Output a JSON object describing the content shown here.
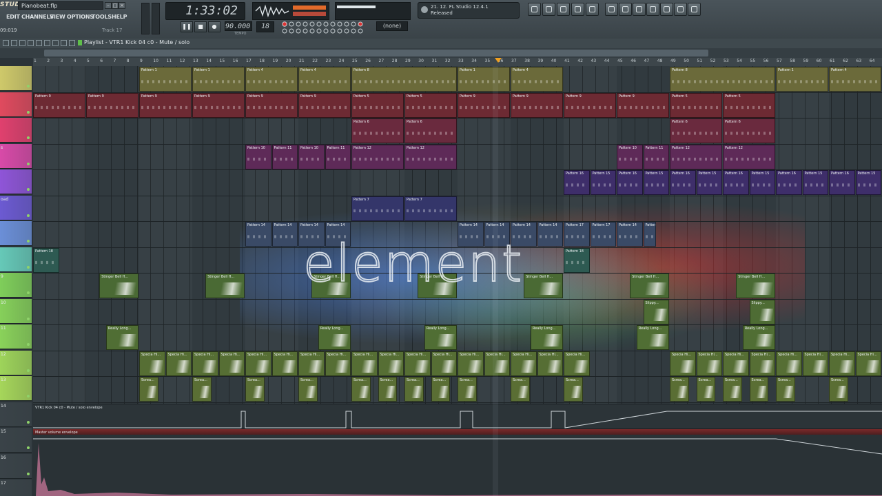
{
  "app": {
    "logo": "STUDIO",
    "filename": "Pianobeat.flp",
    "cpu": "09:019",
    "track": "Track 17"
  },
  "menu": [
    {
      "label": "EDIT"
    },
    {
      "label": "CHANNELS"
    },
    {
      "label": "VIEW"
    },
    {
      "label": "OPTIONS"
    },
    {
      "label": "TOOLS"
    },
    {
      "label": "HELP"
    }
  ],
  "transport": {
    "time": "1:33:02",
    "tempo": "90.000",
    "pattern": "18",
    "snap": "(none)",
    "tempo_label": "TEMPO"
  },
  "hint": {
    "line1": "21. 12. FL Studio 12.4.1",
    "line2": "Released"
  },
  "playlist": {
    "title": "Playlist - VTR1 Kick 04 c0 - Mute / solo"
  },
  "ruler": {
    "bars": [
      "1",
      "2",
      "3",
      "4",
      "5",
      "6",
      "7",
      "8",
      "9",
      "10",
      "11",
      "12",
      "13",
      "14",
      "15",
      "16",
      "17",
      "18",
      "19",
      "20",
      "21",
      "22",
      "23",
      "24",
      "25",
      "26",
      "27",
      "28",
      "29",
      "30",
      "31",
      "32",
      "33",
      "34",
      "35",
      "36",
      "37",
      "38",
      "39",
      "40",
      "41",
      "42",
      "43",
      "44",
      "45",
      "46",
      "47",
      "48",
      "49",
      "50",
      "51",
      "52",
      "53",
      "54",
      "55",
      "56",
      "57",
      "58",
      "59",
      "60",
      "61",
      "62",
      "63",
      "64"
    ]
  },
  "tracks": [
    {
      "num": "",
      "color": "#cfc96a"
    },
    {
      "num": "",
      "color": "#e04a5e"
    },
    {
      "num": "",
      "color": "#e0406e"
    },
    {
      "num": "s",
      "color": "#d84aa8"
    },
    {
      "num": "",
      "color": "#8f55d8"
    },
    {
      "num": "oad",
      "color": "#6c5ad2"
    },
    {
      "num": "",
      "color": "#6b8fd8"
    },
    {
      "num": "",
      "color": "#66c9b8"
    },
    {
      "num": "9",
      "color": "#7fce5a"
    },
    {
      "num": "10",
      "color": "#86d05a"
    },
    {
      "num": "11",
      "color": "#8ad25a"
    },
    {
      "num": "12",
      "color": "#9ed45a"
    },
    {
      "num": "13",
      "color": "#a6d65a"
    },
    {
      "num": "14",
      "color": "#3a4348"
    },
    {
      "num": "15",
      "color": "#3a4348"
    },
    {
      "num": "16",
      "color": "#3a4348"
    },
    {
      "num": "17",
      "color": "#3a4348"
    }
  ],
  "clips": [
    {
      "label": "Pattern 1",
      "row": 0,
      "start": 8,
      "len": 4,
      "color": "#6b6a3a"
    },
    {
      "label": "Pattern 1",
      "row": 0,
      "start": 12,
      "len": 4,
      "color": "#6b6a3a"
    },
    {
      "label": "Pattern 4",
      "row": 0,
      "start": 16,
      "len": 4,
      "color": "#6b6a3a"
    },
    {
      "label": "Pattern 4",
      "row": 0,
      "start": 20,
      "len": 4,
      "color": "#6b6a3a"
    },
    {
      "label": "Pattern 8",
      "row": 0,
      "start": 24,
      "len": 8,
      "color": "#6b6a3a"
    },
    {
      "label": "Pattern 1",
      "row": 0,
      "start": 32,
      "len": 4,
      "color": "#6b6a3a"
    },
    {
      "label": "Pattern 4",
      "row": 0,
      "start": 36,
      "len": 4,
      "color": "#6b6a3a"
    },
    {
      "label": "Pattern 8",
      "row": 0,
      "start": 48,
      "len": 8,
      "color": "#6b6a3a"
    },
    {
      "label": "Pattern 1",
      "row": 0,
      "start": 56,
      "len": 4,
      "color": "#6b6a3a"
    },
    {
      "label": "Pattern 4",
      "row": 0,
      "start": 60,
      "len": 4,
      "color": "#6b6a3a"
    },
    {
      "label": "Pattern 9",
      "row": 1,
      "start": 0,
      "len": 4,
      "color": "#6d2a33"
    },
    {
      "label": "Pattern 9",
      "row": 1,
      "start": 4,
      "len": 4,
      "color": "#6d2a33"
    },
    {
      "label": "Pattern 9",
      "row": 1,
      "start": 8,
      "len": 4,
      "color": "#6d2a33"
    },
    {
      "label": "Pattern 9",
      "row": 1,
      "start": 12,
      "len": 4,
      "color": "#6d2a33"
    },
    {
      "label": "Pattern 9",
      "row": 1,
      "start": 16,
      "len": 4,
      "color": "#6d2a33"
    },
    {
      "label": "Pattern 9",
      "row": 1,
      "start": 20,
      "len": 4,
      "color": "#6d2a33"
    },
    {
      "label": "Pattern 5",
      "row": 1,
      "start": 24,
      "len": 4,
      "color": "#6d2a33"
    },
    {
      "label": "Pattern 5",
      "row": 1,
      "start": 28,
      "len": 4,
      "color": "#6d2a33"
    },
    {
      "label": "Pattern 9",
      "row": 1,
      "start": 32,
      "len": 4,
      "color": "#6d2a33"
    },
    {
      "label": "Pattern 9",
      "row": 1,
      "start": 36,
      "len": 4,
      "color": "#6d2a33"
    },
    {
      "label": "Pattern 9",
      "row": 1,
      "start": 40,
      "len": 4,
      "color": "#6d2a33"
    },
    {
      "label": "Pattern 9",
      "row": 1,
      "start": 44,
      "len": 4,
      "color": "#6d2a33"
    },
    {
      "label": "Pattern 5",
      "row": 1,
      "start": 48,
      "len": 4,
      "color": "#6d2a33"
    },
    {
      "label": "Pattern 5",
      "row": 1,
      "start": 52,
      "len": 4,
      "color": "#6d2a33"
    },
    {
      "label": "Pattern 6",
      "row": 2,
      "start": 24,
      "len": 4,
      "color": "#6a2a3e"
    },
    {
      "label": "Pattern 6",
      "row": 2,
      "start": 28,
      "len": 4,
      "color": "#6a2a3e"
    },
    {
      "label": "Pattern 6",
      "row": 2,
      "start": 48,
      "len": 4,
      "color": "#6a2a3e"
    },
    {
      "label": "Pattern 6",
      "row": 2,
      "start": 52,
      "len": 4,
      "color": "#6a2a3e"
    },
    {
      "label": "Pattern 10",
      "row": 3,
      "start": 16,
      "len": 2,
      "color": "#5e2a58"
    },
    {
      "label": "Pattern 11",
      "row": 3,
      "start": 18,
      "len": 2,
      "color": "#5e2a58"
    },
    {
      "label": "Pattern 10",
      "row": 3,
      "start": 20,
      "len": 2,
      "color": "#5e2a58"
    },
    {
      "label": "Pattern 11",
      "row": 3,
      "start": 22,
      "len": 2,
      "color": "#5e2a58"
    },
    {
      "label": "Pattern 12",
      "row": 3,
      "start": 24,
      "len": 4,
      "color": "#5e2a58"
    },
    {
      "label": "Pattern 12",
      "row": 3,
      "start": 28,
      "len": 4,
      "color": "#5e2a58"
    },
    {
      "label": "Pattern 10",
      "row": 3,
      "start": 44,
      "len": 2,
      "color": "#5e2a58"
    },
    {
      "label": "Pattern 11",
      "row": 3,
      "start": 46,
      "len": 2,
      "color": "#5e2a58"
    },
    {
      "label": "Pattern 12",
      "row": 3,
      "start": 48,
      "len": 4,
      "color": "#5e2a58"
    },
    {
      "label": "Pattern 12",
      "row": 3,
      "start": 52,
      "len": 4,
      "color": "#5e2a58"
    },
    {
      "label": "Pattern 16",
      "row": 4,
      "start": 40,
      "len": 2,
      "color": "#3e2e6a"
    },
    {
      "label": "Pattern 15",
      "row": 4,
      "start": 42,
      "len": 2,
      "color": "#3e2e6a"
    },
    {
      "label": "Pattern 16",
      "row": 4,
      "start": 44,
      "len": 2,
      "color": "#3e2e6a"
    },
    {
      "label": "Pattern 15",
      "row": 4,
      "start": 46,
      "len": 2,
      "color": "#3e2e6a"
    },
    {
      "label": "Pattern 16",
      "row": 4,
      "start": 48,
      "len": 2,
      "color": "#3e2e6a"
    },
    {
      "label": "Pattern 15",
      "row": 4,
      "start": 50,
      "len": 2,
      "color": "#3e2e6a"
    },
    {
      "label": "Pattern 16",
      "row": 4,
      "start": 52,
      "len": 2,
      "color": "#3e2e6a"
    },
    {
      "label": "Pattern 15",
      "row": 4,
      "start": 54,
      "len": 2,
      "color": "#3e2e6a"
    },
    {
      "label": "Pattern 16",
      "row": 4,
      "start": 56,
      "len": 2,
      "color": "#3e2e6a"
    },
    {
      "label": "Pattern 15",
      "row": 4,
      "start": 58,
      "len": 2,
      "color": "#3e2e6a"
    },
    {
      "label": "Pattern 16",
      "row": 4,
      "start": 60,
      "len": 2,
      "color": "#3e2e6a"
    },
    {
      "label": "Pattern 15",
      "row": 4,
      "start": 62,
      "len": 2,
      "color": "#3e2e6a"
    },
    {
      "label": "Pattern 7",
      "row": 5,
      "start": 24,
      "len": 4,
      "color": "#34366a"
    },
    {
      "label": "Pattern 7",
      "row": 5,
      "start": 28,
      "len": 4,
      "color": "#34366a"
    },
    {
      "label": "Pattern 14",
      "row": 6,
      "start": 16,
      "len": 2,
      "color": "#3a4a66"
    },
    {
      "label": "Pattern 14",
      "row": 6,
      "start": 18,
      "len": 2,
      "color": "#3a4a66"
    },
    {
      "label": "Pattern 14",
      "row": 6,
      "start": 20,
      "len": 2,
      "color": "#3a4a66"
    },
    {
      "label": "Pattern 14",
      "row": 6,
      "start": 22,
      "len": 2,
      "color": "#3a4a66"
    },
    {
      "label": "Pattern 14",
      "row": 6,
      "start": 32,
      "len": 2,
      "color": "#3a4a66"
    },
    {
      "label": "Pattern 14",
      "row": 6,
      "start": 34,
      "len": 2,
      "color": "#3a4a66"
    },
    {
      "label": "Pattern 14",
      "row": 6,
      "start": 36,
      "len": 2,
      "color": "#3a4a66"
    },
    {
      "label": "Pattern 14",
      "row": 6,
      "start": 38,
      "len": 2,
      "color": "#3a4a66"
    },
    {
      "label": "Pattern 17",
      "row": 6,
      "start": 40,
      "len": 2,
      "color": "#3a4a66"
    },
    {
      "label": "Pattern 17",
      "row": 6,
      "start": 42,
      "len": 2,
      "color": "#3a4a66"
    },
    {
      "label": "Pattern 14",
      "row": 6,
      "start": 44,
      "len": 2,
      "color": "#3a4a66"
    },
    {
      "label": "Pattern 14",
      "row": 6,
      "start": 46,
      "len": 1,
      "color": "#3a4a66"
    },
    {
      "label": "Pattern 18",
      "row": 7,
      "start": 0,
      "len": 2,
      "color": "#2e5a52"
    },
    {
      "label": "Pattern 18",
      "row": 7,
      "start": 40,
      "len": 2,
      "color": "#2e5a52"
    },
    {
      "label": "Stinger Bell H...",
      "row": 8,
      "start": 5,
      "len": 3,
      "color": "#4a6a34"
    },
    {
      "label": "Stinger Bell H...",
      "row": 8,
      "start": 13,
      "len": 3,
      "color": "#4a6a34"
    },
    {
      "label": "Stinger Bell H...",
      "row": 8,
      "start": 21,
      "len": 3,
      "color": "#4a6a34"
    },
    {
      "label": "Stinger Bell H...",
      "row": 8,
      "start": 29,
      "len": 3,
      "color": "#4a6a34"
    },
    {
      "label": "Stinger Bell H...",
      "row": 8,
      "start": 37,
      "len": 3,
      "color": "#4a6a34"
    },
    {
      "label": "Stinger Bell H...",
      "row": 8,
      "start": 45,
      "len": 3,
      "color": "#4a6a34"
    },
    {
      "label": "Stinger Bell H...",
      "row": 8,
      "start": 53,
      "len": 3,
      "color": "#4a6a34"
    },
    {
      "label": "Slippy...",
      "row": 9,
      "start": 46,
      "len": 2,
      "color": "#4e6c34"
    },
    {
      "label": "Slippy...",
      "row": 9,
      "start": 54,
      "len": 2,
      "color": "#4e6c34"
    },
    {
      "label": "Really Long...",
      "row": 10,
      "start": 5.5,
      "len": 2.5,
      "color": "#506e34"
    },
    {
      "label": "Really Long...",
      "row": 10,
      "start": 21.5,
      "len": 2.5,
      "color": "#506e34"
    },
    {
      "label": "Really Long...",
      "row": 10,
      "start": 29.5,
      "len": 2.5,
      "color": "#506e34"
    },
    {
      "label": "Really Long...",
      "row": 10,
      "start": 37.5,
      "len": 2.5,
      "color": "#506e34"
    },
    {
      "label": "Really Long...",
      "row": 10,
      "start": 45.5,
      "len": 2.5,
      "color": "#506e34"
    },
    {
      "label": "Really Long...",
      "row": 10,
      "start": 53.5,
      "len": 2.5,
      "color": "#506e34"
    },
    {
      "label": "Specia Hi...",
      "row": 11,
      "start": 8,
      "len": 2,
      "color": "#566e34"
    },
    {
      "label": "Specia Hi...",
      "row": 11,
      "start": 10,
      "len": 2,
      "color": "#566e34"
    },
    {
      "label": "Specia Hi...",
      "row": 11,
      "start": 12,
      "len": 2,
      "color": "#566e34"
    },
    {
      "label": "Specia Hi...",
      "row": 11,
      "start": 14,
      "len": 2,
      "color": "#566e34"
    },
    {
      "label": "Specia Hi...",
      "row": 11,
      "start": 16,
      "len": 2,
      "color": "#566e34"
    },
    {
      "label": "Specia Hi...",
      "row": 11,
      "start": 18,
      "len": 2,
      "color": "#566e34"
    },
    {
      "label": "Specia Hi...",
      "row": 11,
      "start": 20,
      "len": 2,
      "color": "#566e34"
    },
    {
      "label": "Specia Hi...",
      "row": 11,
      "start": 22,
      "len": 2,
      "color": "#566e34"
    },
    {
      "label": "Specia Hi...",
      "row": 11,
      "start": 24,
      "len": 2,
      "color": "#566e34"
    },
    {
      "label": "Specia Hi...",
      "row": 11,
      "start": 26,
      "len": 2,
      "color": "#566e34"
    },
    {
      "label": "Specia Hi...",
      "row": 11,
      "start": 28,
      "len": 2,
      "color": "#566e34"
    },
    {
      "label": "Specia Hi...",
      "row": 11,
      "start": 30,
      "len": 2,
      "color": "#566e34"
    },
    {
      "label": "Specia Hi...",
      "row": 11,
      "start": 32,
      "len": 2,
      "color": "#566e34"
    },
    {
      "label": "Specia Hi...",
      "row": 11,
      "start": 34,
      "len": 2,
      "color": "#566e34"
    },
    {
      "label": "Specia Hi...",
      "row": 11,
      "start": 36,
      "len": 2,
      "color": "#566e34"
    },
    {
      "label": "Specia Hi...",
      "row": 11,
      "start": 38,
      "len": 2,
      "color": "#566e34"
    },
    {
      "label": "Specia Hi...",
      "row": 11,
      "start": 40,
      "len": 2,
      "color": "#566e34"
    },
    {
      "label": "Specia Hi...",
      "row": 11,
      "start": 48,
      "len": 2,
      "color": "#566e34"
    },
    {
      "label": "Specia Hi...",
      "row": 11,
      "start": 50,
      "len": 2,
      "color": "#566e34"
    },
    {
      "label": "Specia Hi...",
      "row": 11,
      "start": 52,
      "len": 2,
      "color": "#566e34"
    },
    {
      "label": "Specia Hi...",
      "row": 11,
      "start": 54,
      "len": 2,
      "color": "#566e34"
    },
    {
      "label": "Specia Hi...",
      "row": 11,
      "start": 56,
      "len": 2,
      "color": "#566e34"
    },
    {
      "label": "Specia Hi...",
      "row": 11,
      "start": 58,
      "len": 2,
      "color": "#566e34"
    },
    {
      "label": "Specia Hi...",
      "row": 11,
      "start": 60,
      "len": 2,
      "color": "#566e34"
    },
    {
      "label": "Specia Hi...",
      "row": 11,
      "start": 62,
      "len": 2,
      "color": "#566e34"
    },
    {
      "label": "Screa...",
      "row": 12,
      "start": 8,
      "len": 1.5,
      "color": "#5a6e34"
    },
    {
      "label": "Screa...",
      "row": 12,
      "start": 12,
      "len": 1.5,
      "color": "#5a6e34"
    },
    {
      "label": "Screa...",
      "row": 12,
      "start": 16,
      "len": 1.5,
      "color": "#5a6e34"
    },
    {
      "label": "Screa...",
      "row": 12,
      "start": 20,
      "len": 1.5,
      "color": "#5a6e34"
    },
    {
      "label": "Screa...",
      "row": 12,
      "start": 24,
      "len": 1.5,
      "color": "#5a6e34"
    },
    {
      "label": "Screa...",
      "row": 12,
      "start": 26,
      "len": 1.5,
      "color": "#5a6e34"
    },
    {
      "label": "Screa...",
      "row": 12,
      "start": 28,
      "len": 1.5,
      "color": "#5a6e34"
    },
    {
      "label": "Screa...",
      "row": 12,
      "start": 30,
      "len": 1.5,
      "color": "#5a6e34"
    },
    {
      "label": "Screa...",
      "row": 12,
      "start": 32,
      "len": 1.5,
      "color": "#5a6e34"
    },
    {
      "label": "Screa...",
      "row": 12,
      "start": 36,
      "len": 1.5,
      "color": "#5a6e34"
    },
    {
      "label": "Screa...",
      "row": 12,
      "start": 40,
      "len": 1.5,
      "color": "#5a6e34"
    },
    {
      "label": "Screa...",
      "row": 12,
      "start": 48,
      "len": 1.5,
      "color": "#5a6e34"
    },
    {
      "label": "Screa...",
      "row": 12,
      "start": 50,
      "len": 1.5,
      "color": "#5a6e34"
    },
    {
      "label": "Screa...",
      "row": 12,
      "start": 52,
      "len": 1.5,
      "color": "#5a6e34"
    },
    {
      "label": "Screa...",
      "row": 12,
      "start": 54,
      "len": 1.5,
      "color": "#5a6e34"
    },
    {
      "label": "Screa...",
      "row": 12,
      "start": 56,
      "len": 1.5,
      "color": "#5a6e34"
    },
    {
      "label": "Screa...",
      "row": 12,
      "start": 60,
      "len": 1.5,
      "color": "#5a6e34"
    }
  ],
  "automation": {
    "lane1": "VTR1 Kick 04 c0 - Mute / solo envelope",
    "lane2": "Master volume envelope"
  },
  "splash": {
    "word": "element"
  }
}
